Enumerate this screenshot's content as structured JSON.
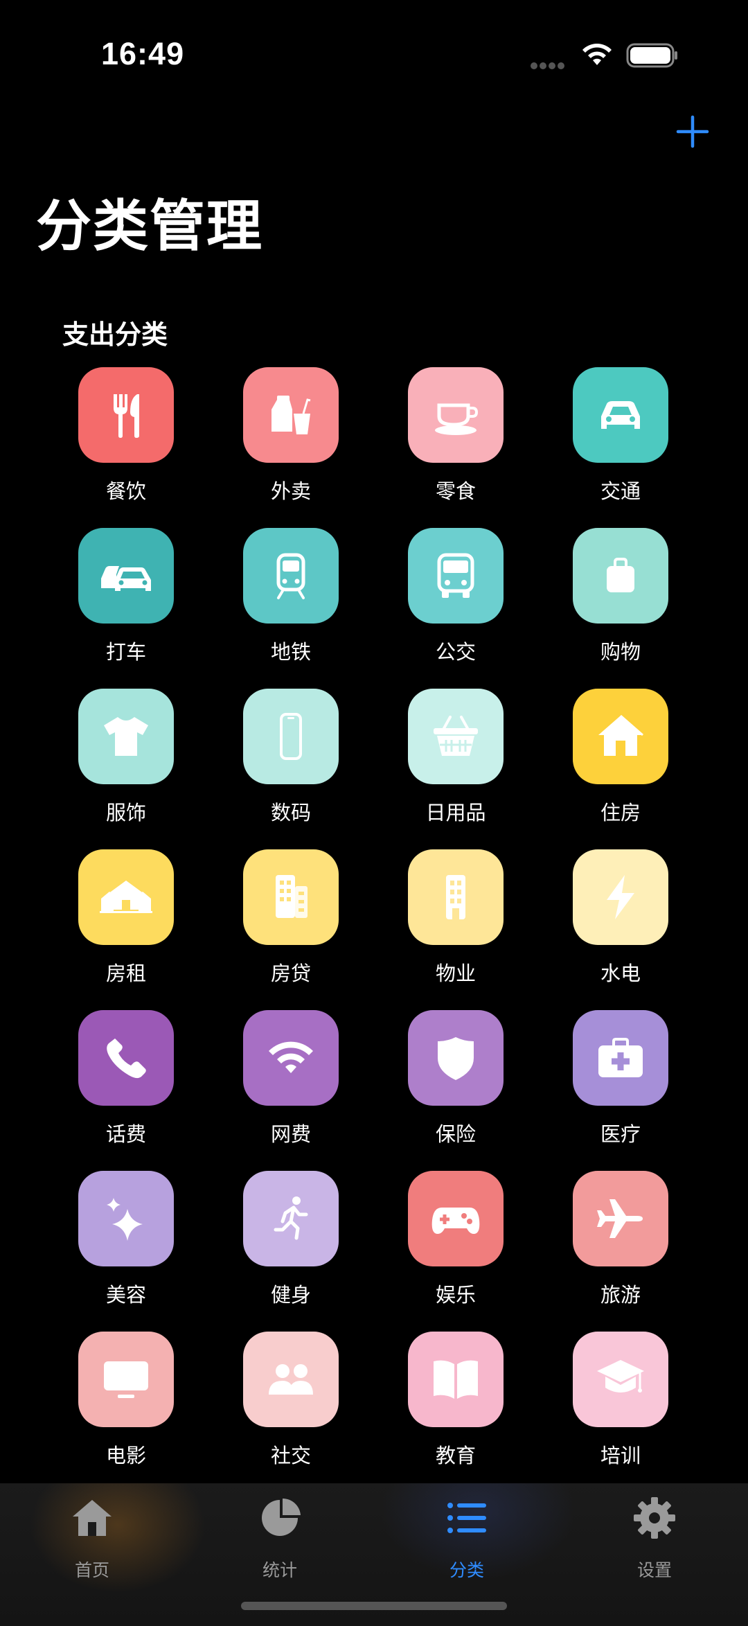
{
  "status": {
    "time": "16:49"
  },
  "header": {
    "title": "分类管理",
    "add_icon": "plus-icon"
  },
  "section": {
    "title": "支出分类"
  },
  "categories": [
    {
      "label": "餐饮",
      "icon": "fork-knife-icon",
      "color": "#F46B6B"
    },
    {
      "label": "外卖",
      "icon": "takeout-icon",
      "color": "#F78A8E"
    },
    {
      "label": "零食",
      "icon": "coffee-cup-icon",
      "color": "#F9B0B9"
    },
    {
      "label": "交通",
      "icon": "car-icon",
      "color": "#4DC9C0"
    },
    {
      "label": "打车",
      "icon": "cars-icon",
      "color": "#3FB3B2"
    },
    {
      "label": "地铁",
      "icon": "tram-icon",
      "color": "#5DC7C6"
    },
    {
      "label": "公交",
      "icon": "bus-icon",
      "color": "#6CCFCF"
    },
    {
      "label": "购物",
      "icon": "bag-icon",
      "color": "#97DFD3"
    },
    {
      "label": "服饰",
      "icon": "tshirt-icon",
      "color": "#A6E4DC"
    },
    {
      "label": "数码",
      "icon": "phone-device-icon",
      "color": "#B8EAE3"
    },
    {
      "label": "日用品",
      "icon": "basket-icon",
      "color": "#C8F0EA"
    },
    {
      "label": "住房",
      "icon": "house-icon",
      "color": "#FDD13B"
    },
    {
      "label": "房租",
      "icon": "houses-icon",
      "color": "#FDDB5E"
    },
    {
      "label": "房贷",
      "icon": "building-icon",
      "color": "#FEE17B"
    },
    {
      "label": "物业",
      "icon": "tower-icon",
      "color": "#FEE698"
    },
    {
      "label": "水电",
      "icon": "bolt-icon",
      "color": "#FEEFB8"
    },
    {
      "label": "话费",
      "icon": "phone-icon",
      "color": "#9B59B6"
    },
    {
      "label": "网费",
      "icon": "wifi-icon",
      "color": "#A76FC4"
    },
    {
      "label": "保险",
      "icon": "shield-icon",
      "color": "#AE7FCB"
    },
    {
      "label": "医疗",
      "icon": "medical-kit-icon",
      "color": "#A68FD8"
    },
    {
      "label": "美容",
      "icon": "sparkles-icon",
      "color": "#B7A1DE"
    },
    {
      "label": "健身",
      "icon": "runner-icon",
      "color": "#C9B5E6"
    },
    {
      "label": "娱乐",
      "icon": "gamepad-icon",
      "color": "#F07D7D"
    },
    {
      "label": "旅游",
      "icon": "airplane-icon",
      "color": "#F29B9B"
    },
    {
      "label": "电影",
      "icon": "tv-icon",
      "color": "#F4B1B1"
    },
    {
      "label": "社交",
      "icon": "people-icon",
      "color": "#F8CDCD"
    },
    {
      "label": "教育",
      "icon": "book-icon",
      "color": "#F7B7CC"
    },
    {
      "label": "培训",
      "icon": "graduation-cap-icon",
      "color": "#F9C6D8"
    }
  ],
  "tabs": [
    {
      "label": "首页",
      "icon": "house-icon",
      "active": false
    },
    {
      "label": "统计",
      "icon": "pie-chart-icon",
      "active": false
    },
    {
      "label": "分类",
      "icon": "list-icon",
      "active": true
    },
    {
      "label": "设置",
      "icon": "gear-icon",
      "active": false
    }
  ],
  "colors": {
    "accent": "#2F8CFF",
    "inactive_tab": "#9A9A9A"
  }
}
